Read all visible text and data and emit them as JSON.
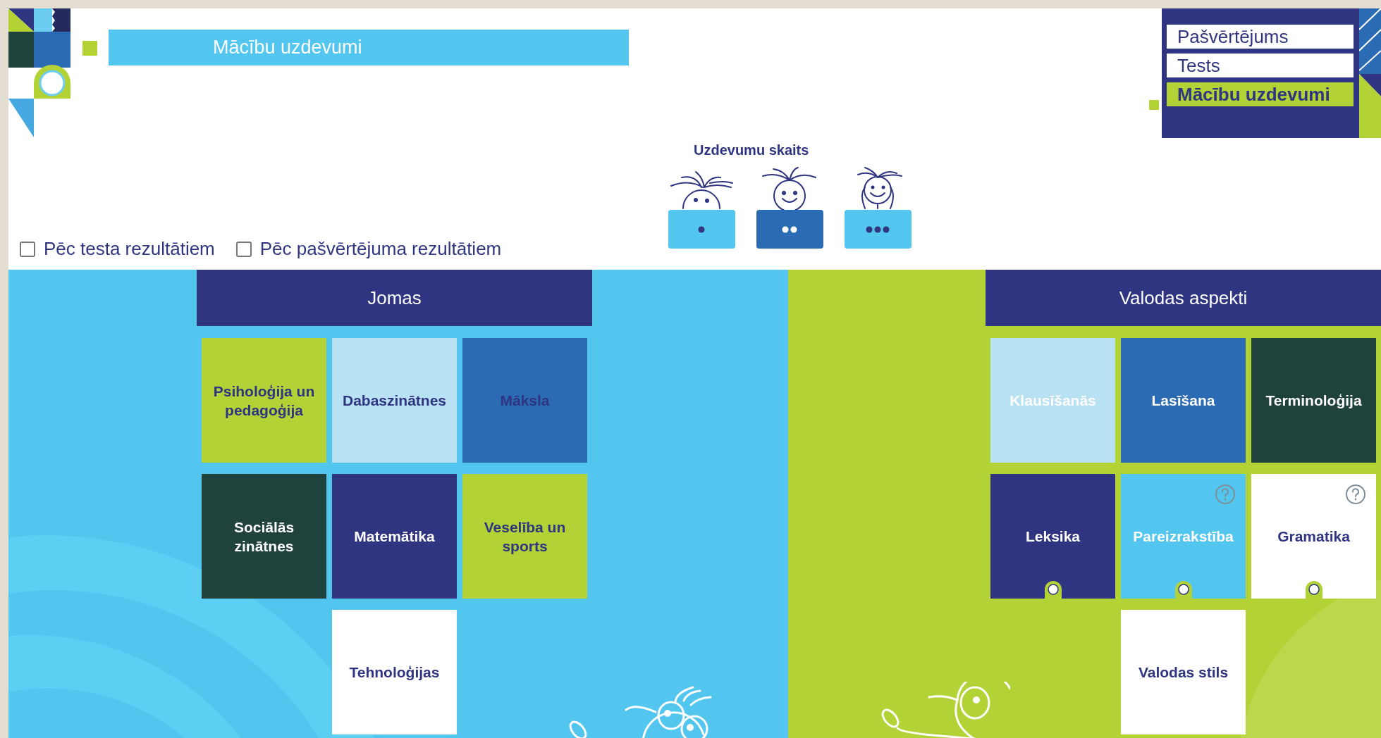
{
  "header": {
    "title": "Mācību uzdevumi"
  },
  "menu": [
    {
      "label": "Pašvērtējums",
      "selected": false
    },
    {
      "label": "Tests",
      "selected": false
    },
    {
      "label": "Mācību uzdevumi",
      "selected": true
    }
  ],
  "task_count": {
    "heading": "Uzdevumu skaits",
    "options": [
      {
        "kind": "peek",
        "selected": false
      },
      {
        "kind": "smile",
        "selected": true
      },
      {
        "kind": "hands",
        "selected": false
      }
    ]
  },
  "filters": [
    {
      "label": "Pēc testa rezultātiem",
      "checked": false
    },
    {
      "label": "Pēc pašvērtējuma rezultātiem",
      "checked": false
    }
  ],
  "jomas": {
    "title": "Jomas",
    "tiles": [
      {
        "label": "Psiholoģija un pedagoģija",
        "color": "#b3d236",
        "kind": "dark"
      },
      {
        "label": "Dabaszinātnes",
        "color": "#b8e2f4",
        "kind": "dark"
      },
      {
        "label": "Māksla",
        "color": "#2b6bb3",
        "kind": "dark"
      },
      {
        "label": "Sociālās zinātnes",
        "color": "#1f423c",
        "kind": "light"
      },
      {
        "label": "Matemātika",
        "color": "#2f3580",
        "kind": "light"
      },
      {
        "label": "Veselība un sports",
        "color": "#b3d236",
        "kind": "dark"
      },
      {
        "label": "Tehnoloģijas",
        "color": "#ffffff",
        "kind": "dark"
      }
    ]
  },
  "valodas_aspekti": {
    "title": "Valodas aspekti",
    "tiles": [
      {
        "label": "Klausīšanās",
        "color": "#b8e2f4",
        "kind": "light"
      },
      {
        "label": "Lasīšana",
        "color": "#2b6bb3",
        "kind": "light"
      },
      {
        "label": "Terminoloģija",
        "color": "#1f423c",
        "kind": "light"
      },
      {
        "label": "Leksika",
        "color": "#2f3580",
        "kind": "light_marked"
      },
      {
        "label": "Pareizrakstība",
        "color": "#52c6ef",
        "kind": "light_help"
      },
      {
        "label": "Gramatika",
        "color": "#ffffff",
        "kind": "dark_help"
      },
      {
        "label": "Valodas stils",
        "color": "#ffffff",
        "kind": "dark"
      }
    ]
  }
}
